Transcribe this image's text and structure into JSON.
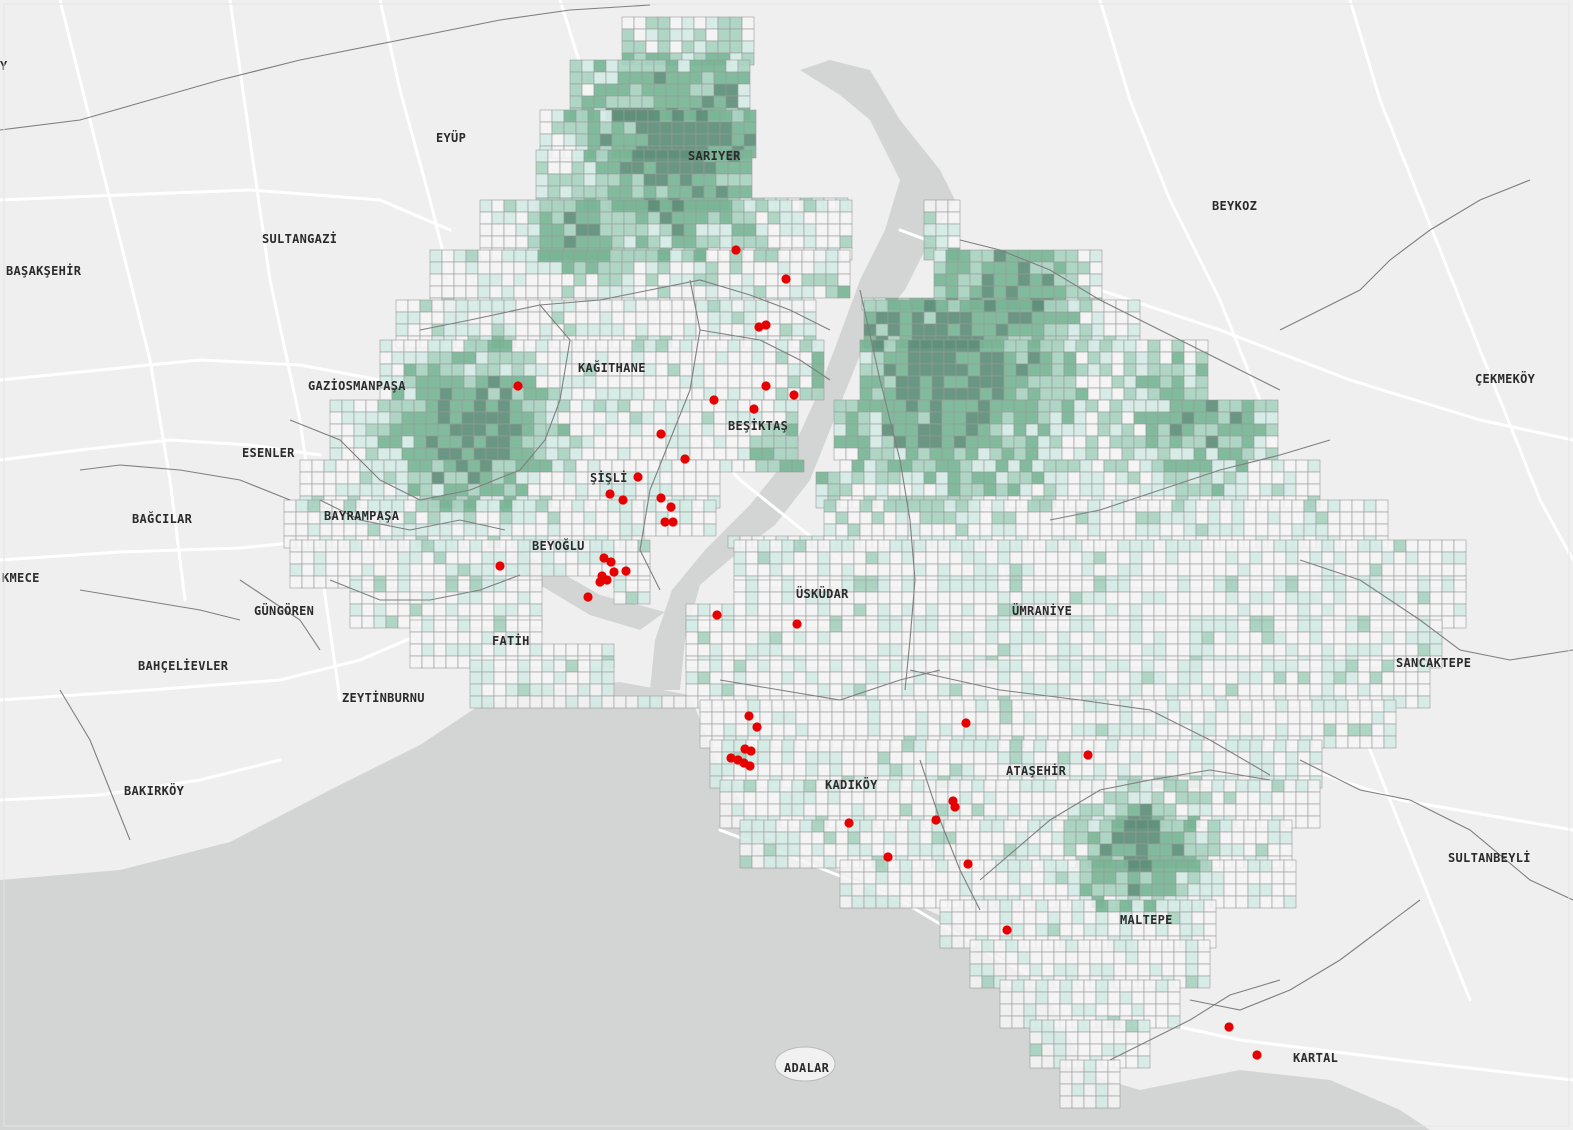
{
  "districts": [
    {
      "id": "sariyer",
      "label": "SARIYER"
    },
    {
      "id": "eyup",
      "label": "EYÜP"
    },
    {
      "id": "sultangazi",
      "label": "SULTANGAZİ"
    },
    {
      "id": "basaksehir",
      "label": "BAŞAKŞEHİR"
    },
    {
      "id": "beykoz",
      "label": "BEYKOZ"
    },
    {
      "id": "kagithane",
      "label": "KAĞITHANE"
    },
    {
      "id": "gaziosmanpasa",
      "label": "GAZİOSMANPAŞA"
    },
    {
      "id": "besiktas",
      "label": "BEŞİKTAŞ"
    },
    {
      "id": "cekmekoy",
      "label": "ÇEKMEKÖY"
    },
    {
      "id": "esenler",
      "label": "ESENLER"
    },
    {
      "id": "sisli",
      "label": "ŞİŞLİ"
    },
    {
      "id": "bagcilar",
      "label": "BAĞCILAR"
    },
    {
      "id": "bayrampasa",
      "label": "BAYRAMPAŞA"
    },
    {
      "id": "beyoglu",
      "label": "BEYOĞLU"
    },
    {
      "id": "kmece",
      "label": "KMECE"
    },
    {
      "id": "uskudar",
      "label": "ÜSKÜDAR"
    },
    {
      "id": "gungoren",
      "label": "GÜNGÖREN"
    },
    {
      "id": "umraniye",
      "label": "ÜMRANİYE"
    },
    {
      "id": "fatih",
      "label": "FATİH"
    },
    {
      "id": "sancaktepe",
      "label": "SANCAKTEPE"
    },
    {
      "id": "bahcelievler",
      "label": "BAHÇELİEVLER"
    },
    {
      "id": "zeytinburnu",
      "label": "ZEYTİNBURNU"
    },
    {
      "id": "atasehir",
      "label": "ATAŞEHİR"
    },
    {
      "id": "kadikoy",
      "label": "KADIKÖY"
    },
    {
      "id": "bakirkoy",
      "label": "BAKIRKÖY"
    },
    {
      "id": "sultanbeyli",
      "label": "SULTANBEYLİ"
    },
    {
      "id": "maltepe",
      "label": "MALTEPE"
    },
    {
      "id": "adalar",
      "label": "ADALAR"
    },
    {
      "id": "kartal",
      "label": "KARTAL"
    }
  ],
  "edge_fragment": "Y",
  "colors": {
    "land": "#efefef",
    "sea": "#d3d4d4",
    "roads": "#ffffff",
    "borders": "#7f7f7f",
    "grid_line": "#9a9a9a",
    "class0": "#f4f5f5",
    "class1": "#d6ebe6",
    "class2": "#a9d3c1",
    "class3": "#78b596",
    "class4": "#5e8f7a",
    "points": "#e60000"
  }
}
